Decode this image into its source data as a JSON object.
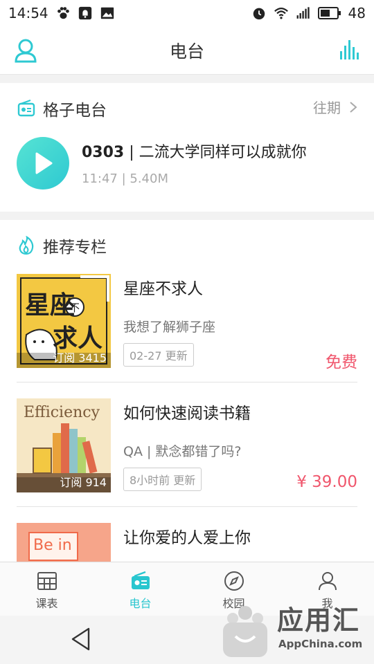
{
  "status_bar": {
    "time": "14:54",
    "battery": "48"
  },
  "header": {
    "title": "电台"
  },
  "radio": {
    "section_title": "格子电台",
    "more": "往期",
    "episode": {
      "number": "0303",
      "separator": " | ",
      "title": "二流大学同样可以成就你",
      "meta": "11:47 | 5.40M"
    }
  },
  "recommend": {
    "section_title": "推荐专栏",
    "courses": [
      {
        "name": "星座不求人",
        "desc": "我想了解狮子座",
        "tag": "02-27 更新",
        "price": "免费",
        "subs": "订阅 3415",
        "cover": {
          "line1": "星座",
          "badge": "不",
          "line2": "求人"
        }
      },
      {
        "name": "如何快速阅读书籍",
        "desc": "QA | 默念都错了吗?",
        "tag": "8小时前 更新",
        "price": "¥ 39.00",
        "subs": "订阅 914",
        "cover": {
          "word": "Efficiency"
        }
      },
      {
        "name": "让你爱的人爱上你",
        "cover": {
          "line1": "Be in"
        }
      }
    ]
  },
  "tabs": [
    {
      "label": "课表",
      "icon": "timetable-icon"
    },
    {
      "label": "电台",
      "icon": "radio-icon",
      "active": true
    },
    {
      "label": "校园",
      "icon": "compass-icon"
    },
    {
      "label": "我",
      "icon": "person-icon"
    }
  ],
  "watermark": {
    "text": "应用汇",
    "sub": "AppChina.com"
  },
  "colors": {
    "accent": "#28c6cf",
    "price": "#f0566c"
  }
}
